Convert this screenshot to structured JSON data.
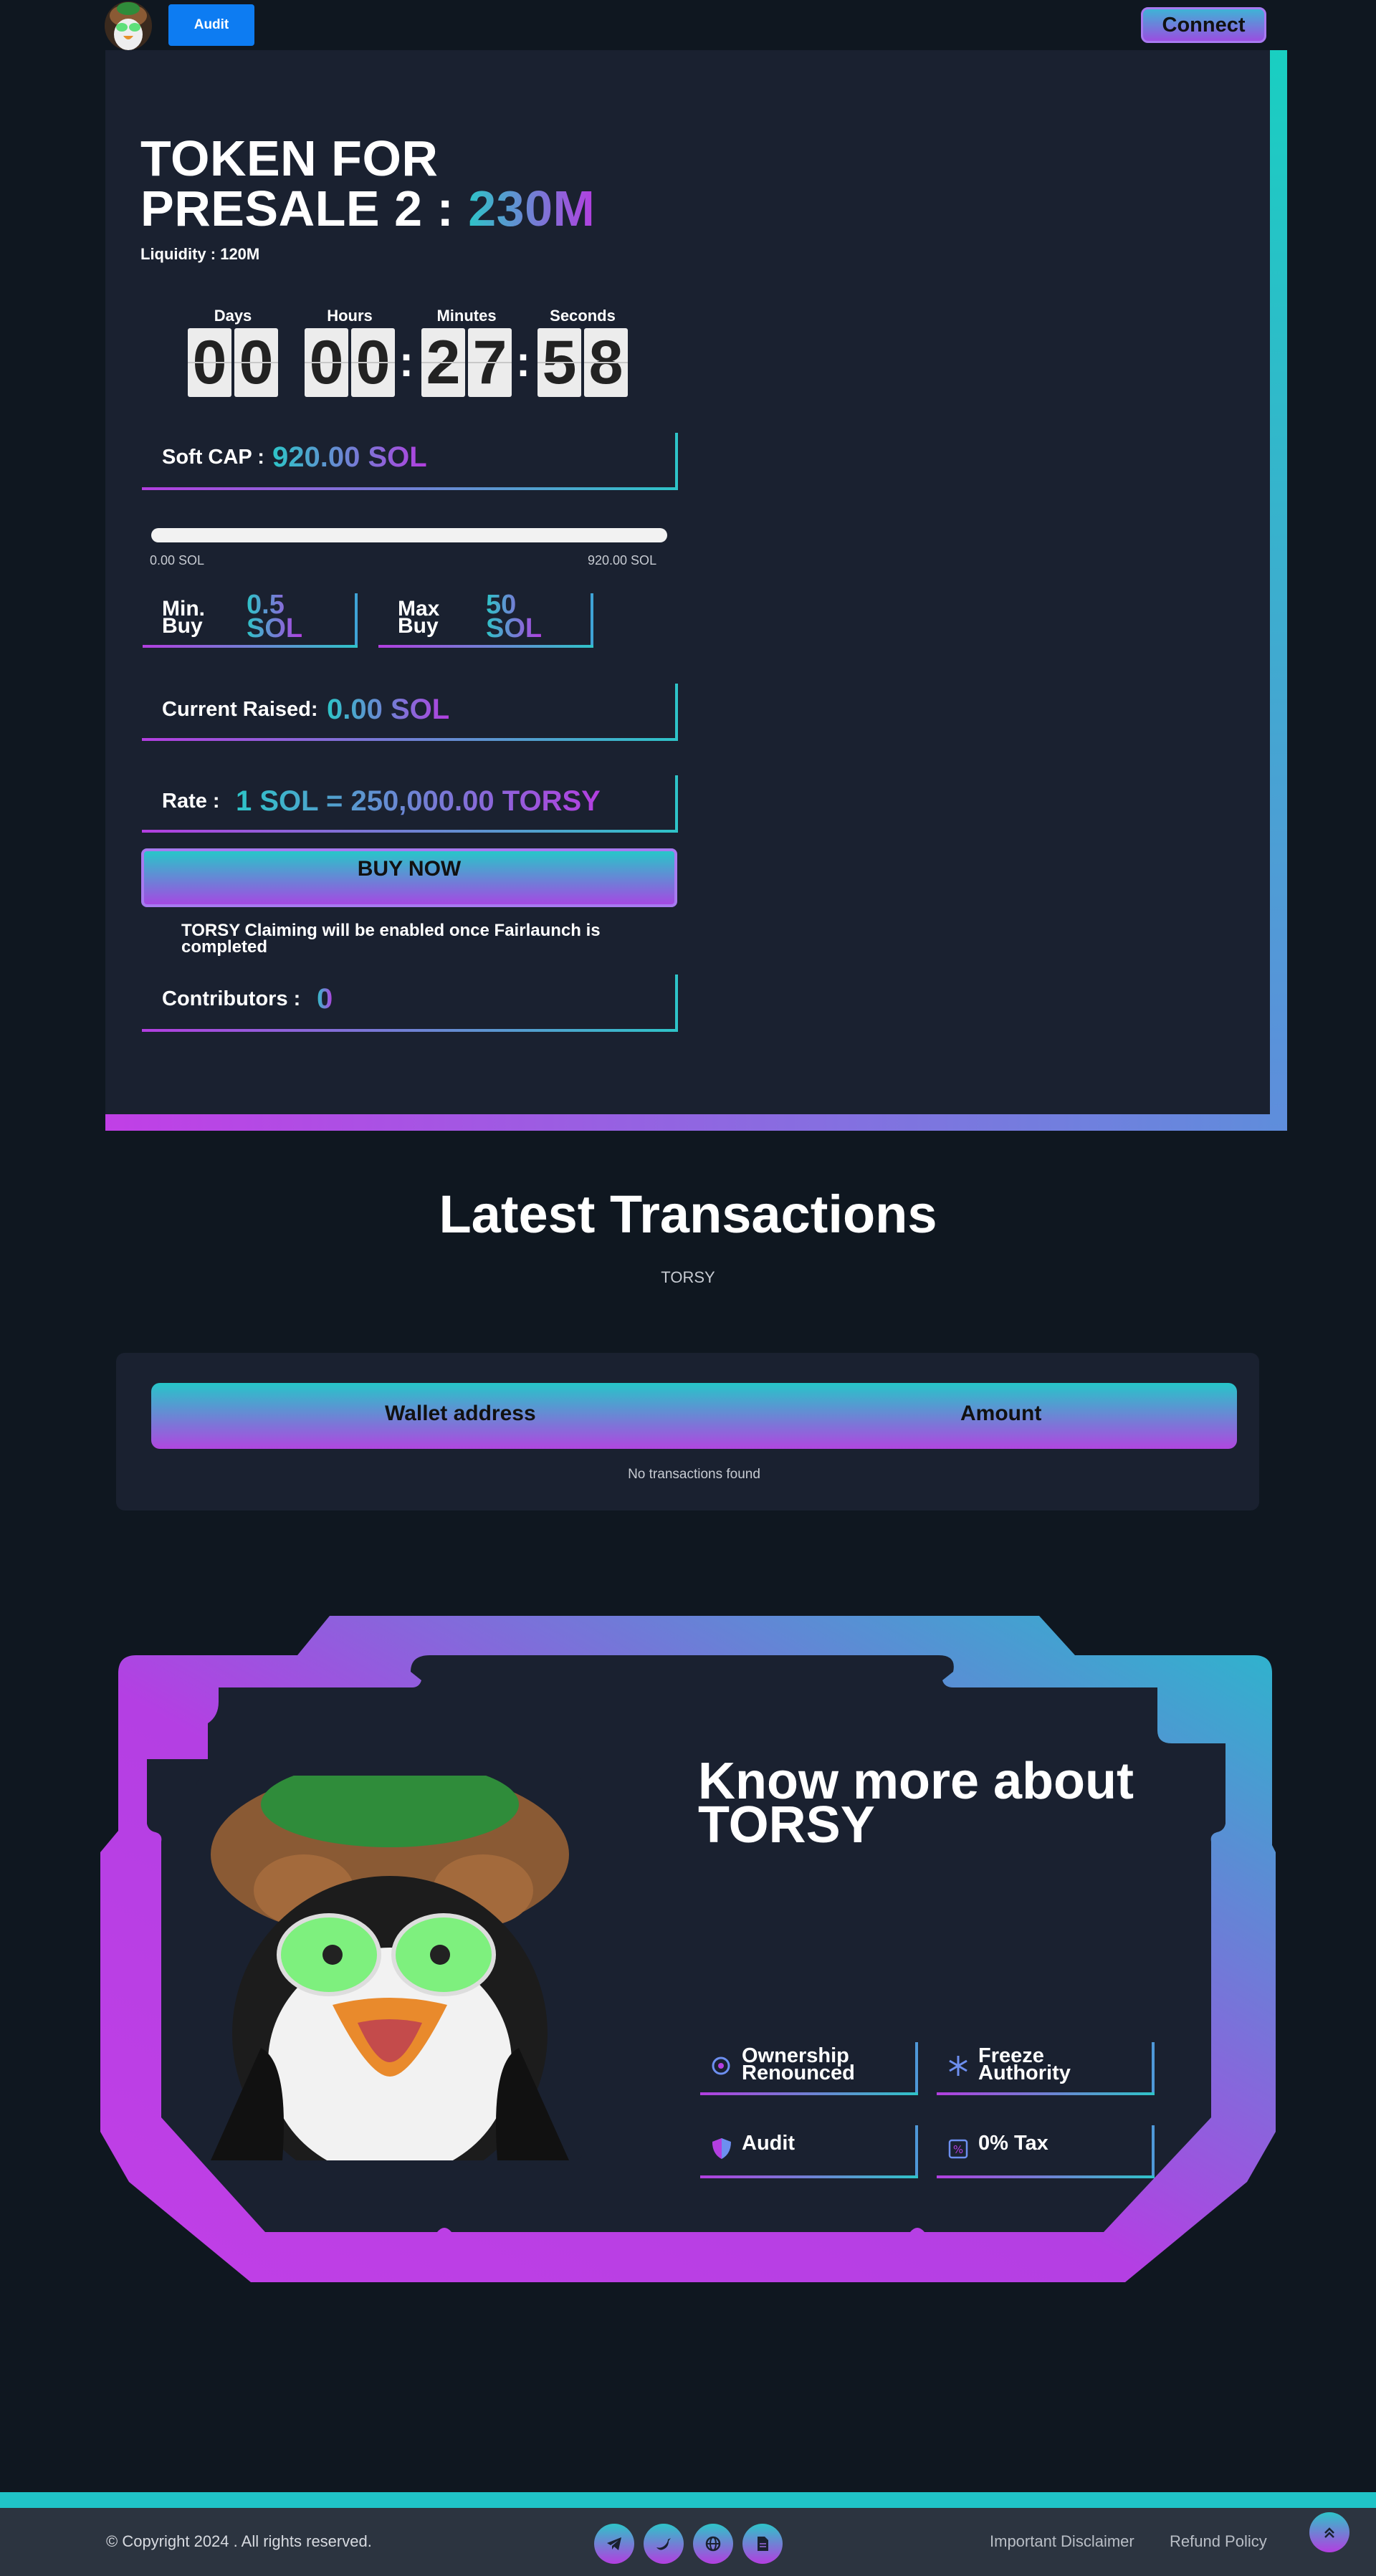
{
  "header": {
    "audit_label": "Audit",
    "connect_label": "Connect",
    "logo_icon": "penguin-logo-icon"
  },
  "presale": {
    "title_line1": "TOKEN FOR",
    "title_line2_prefix": "PRESALE 2 :",
    "title_amount": "230M",
    "liquidity": "Liquidity : 120M",
    "countdown": {
      "days_label": "Days",
      "hours_label": "Hours",
      "minutes_label": "Minutes",
      "seconds_label": "Seconds",
      "days": [
        "0",
        "0"
      ],
      "hours": [
        "0",
        "0"
      ],
      "minutes": [
        "2",
        "7"
      ],
      "seconds": [
        "5",
        "8"
      ],
      "separator": ":"
    },
    "soft_cap_label": "Soft CAP :",
    "soft_cap_value": "920.00 SOL",
    "progress": {
      "fraction": 0,
      "min_label": "0.00 SOL",
      "max_label": "920.00 SOL"
    },
    "min_buy": {
      "label_1": "Min.",
      "label_2": "Buy",
      "value_1": "0.5",
      "value_2": "SOL"
    },
    "max_buy": {
      "label_1": "Max",
      "label_2": "Buy",
      "value_1": "50",
      "value_2": "SOL"
    },
    "current_raised_label": "Current Raised:",
    "current_raised_value": "0.00 SOL",
    "rate_label": "Rate :",
    "rate_value": "1 SOL = 250,000.00 TORSY",
    "buy_label": "BUY NOW",
    "claim_note": "TORSY Claiming will be enabled once Fairlaunch is completed",
    "contributors_label": "Contributors :",
    "contributors_value": "0"
  },
  "transactions": {
    "title": "Latest Transactions",
    "subtitle": "TORSY",
    "columns": [
      "Wallet address",
      "Amount"
    ],
    "empty": "No transactions found"
  },
  "about": {
    "title_1": "Know more about",
    "title_2": "TORSY",
    "features": [
      {
        "line1": "Ownership",
        "line2": "Renounced",
        "icon": "ownership-icon"
      },
      {
        "line1": "Freeze",
        "line2": "Authority",
        "icon": "snowflake-icon"
      },
      {
        "line1": "Audit",
        "line2": "",
        "icon": "shield-icon"
      },
      {
        "line1": "0% Tax",
        "line2": "",
        "icon": "percent-icon"
      }
    ]
  },
  "footer": {
    "copyright": "© Copyright 2024 . All rights reserved.",
    "links": [
      "Important Disclaimer",
      "Refund Policy"
    ],
    "socials": [
      "telegram-icon",
      "twitter-icon",
      "globe-icon",
      "document-icon"
    ]
  },
  "colors": {
    "accent_cyan": "#2ec4c8",
    "accent_purple": "#b33ee0",
    "button_blue": "#0d7cf2",
    "bg": "#0f1720",
    "card": "#1a2130"
  }
}
